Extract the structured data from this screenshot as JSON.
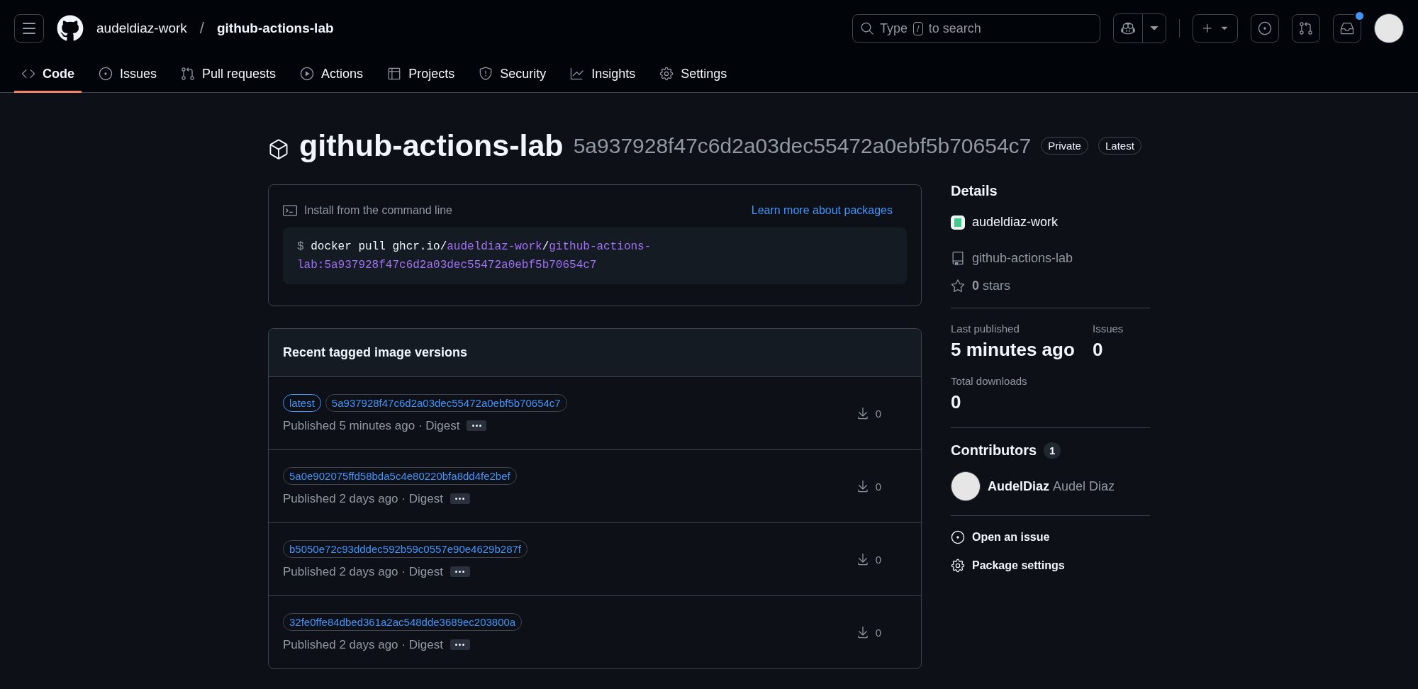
{
  "header": {
    "owner": "audeldiaz-work",
    "separator": "/",
    "repo": "github-actions-lab",
    "search": {
      "placeholder_before": "Type",
      "key": "/",
      "placeholder_after": "to search"
    },
    "notifications": {
      "unread": true
    }
  },
  "tabs": [
    {
      "label": "Code",
      "selected": true
    },
    {
      "label": "Issues",
      "selected": false
    },
    {
      "label": "Pull requests",
      "selected": false
    },
    {
      "label": "Actions",
      "selected": false
    },
    {
      "label": "Projects",
      "selected": false
    },
    {
      "label": "Security",
      "selected": false
    },
    {
      "label": "Insights",
      "selected": false
    },
    {
      "label": "Settings",
      "selected": false
    }
  ],
  "package": {
    "name": "github-actions-lab",
    "digest": "5a937928f47c6d2a03dec55472a0ebf5b70654c7",
    "badges": [
      "Private",
      "Latest"
    ]
  },
  "install": {
    "label": "Install from the command line",
    "link": "Learn more about packages",
    "command": [
      {
        "kind": "prompt",
        "text": "$ "
      },
      {
        "kind": "plain",
        "text": "docker pull ghcr.io/"
      },
      {
        "kind": "path",
        "text": "audeldiaz-work"
      },
      {
        "kind": "plain",
        "text": "/"
      },
      {
        "kind": "path",
        "text": "github-actions-lab:5a937928f47c6d2a03dec55472a0ebf5b70654c7"
      }
    ]
  },
  "versions": {
    "title": "Recent tagged image versions",
    "rows": [
      {
        "tags": [
          {
            "kind": "latest",
            "label": "latest"
          },
          {
            "kind": "digest",
            "label": "5a937928f47c6d2a03dec55472a0ebf5b70654c7"
          }
        ],
        "published": "Published 5 minutes ago · Digest",
        "downloads": "0"
      },
      {
        "tags": [
          {
            "kind": "digest",
            "label": "5a0e902075ffd58bda5c4e80220bfa8dd4fe2bef"
          }
        ],
        "published": "Published 2 days ago · Digest",
        "downloads": "0"
      },
      {
        "tags": [
          {
            "kind": "digest",
            "label": "b5050e72c93dddec592b59c0557e90e4629b287f"
          }
        ],
        "published": "Published 2 days ago · Digest",
        "downloads": "0"
      },
      {
        "tags": [
          {
            "kind": "digest",
            "label": "32fe0ffe84dbed361a2ac548dde3689ec203800a"
          }
        ],
        "published": "Published 2 days ago · Digest",
        "downloads": "0"
      }
    ]
  },
  "details": {
    "title": "Details",
    "owner": "audeldiaz-work",
    "repo": "github-actions-lab",
    "stars": "**0** stars",
    "stats": [
      {
        "label": "Last published",
        "value": "5 minutes ago"
      },
      {
        "label": "Issues",
        "value": "0"
      },
      {
        "label": "Total downloads",
        "value": "0"
      }
    ]
  },
  "contributors": {
    "title": "Contributors",
    "count": "1",
    "people": [
      {
        "login": "AudelDiaz",
        "name": "Audel Diaz"
      }
    ]
  },
  "actions": [
    {
      "label": "Open an issue"
    },
    {
      "label": "Package settings"
    }
  ]
}
